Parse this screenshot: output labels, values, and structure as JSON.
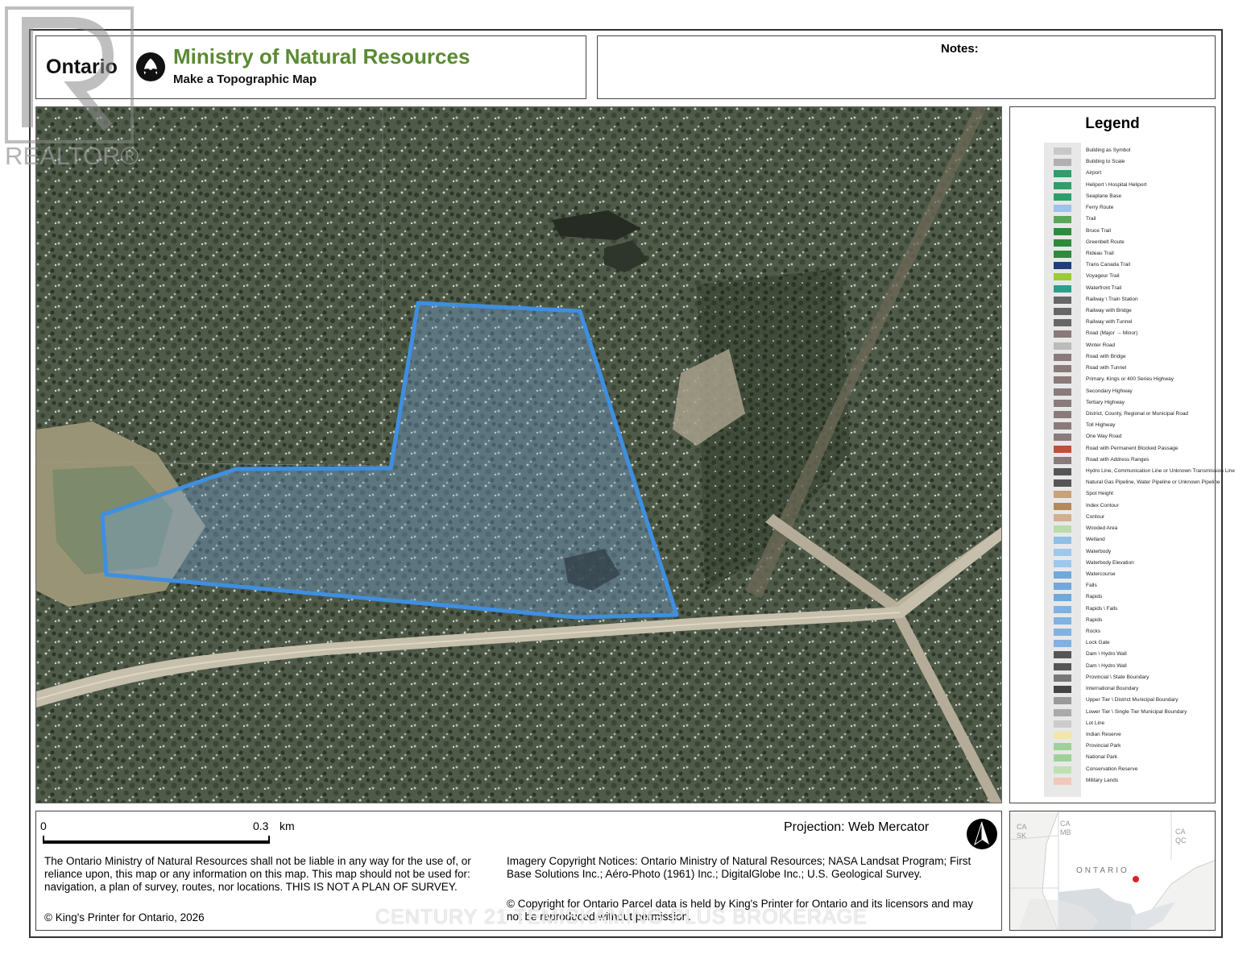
{
  "header": {
    "ontario_wordmark": "Ontario",
    "ministry": "Ministry of Natural Resources",
    "subtitle": "Make a Topographic Map"
  },
  "notes": {
    "label": "Notes:"
  },
  "legend": {
    "title": "Legend",
    "items": [
      {
        "label": "Building as Symbol",
        "color": "#c8c8c8"
      },
      {
        "label": "Building to Scale",
        "color": "#b0b0b0"
      },
      {
        "label": "Airport",
        "color": "#2e9e6a"
      },
      {
        "label": "Heliport \\ Hospital Heliport",
        "color": "#2e9e6a"
      },
      {
        "label": "Seaplane Base",
        "color": "#2e9e6a"
      },
      {
        "label": "Ferry Route",
        "color": "#9cc3ea"
      },
      {
        "label": "Trail",
        "color": "#58a85a"
      },
      {
        "label": "Bruce Trail",
        "color": "#2e8b3c"
      },
      {
        "label": "Greenbelt Route",
        "color": "#2e8b3c"
      },
      {
        "label": "Rideau Trail",
        "color": "#2e8b3c"
      },
      {
        "label": "Trans Canada Trail",
        "color": "#1f3f7a"
      },
      {
        "label": "Voyageur Trail",
        "color": "#9acd32"
      },
      {
        "label": "Waterfront Trail",
        "color": "#2e9e8a"
      },
      {
        "label": "Railway \\ Train Station",
        "color": "#666666"
      },
      {
        "label": "Railway with Bridge",
        "color": "#666666"
      },
      {
        "label": "Railway with Tunnel",
        "color": "#666666"
      },
      {
        "label": "Road (Major → Minor)",
        "color": "#8a7a7a"
      },
      {
        "label": "Winter Road",
        "color": "#bbbbbb"
      },
      {
        "label": "Road with Bridge",
        "color": "#8a7a7a"
      },
      {
        "label": "Road with Tunnel",
        "color": "#8a7a7a"
      },
      {
        "label": "Primary, Kings or 400 Series Highway",
        "color": "#8a7a7a"
      },
      {
        "label": "Secondary Highway",
        "color": "#8a7a7a"
      },
      {
        "label": "Tertiary Highway",
        "color": "#8a7a7a"
      },
      {
        "label": "District, County, Regional or Municipal Road",
        "color": "#8a7a7a"
      },
      {
        "label": "Toll Highway",
        "color": "#8a7a7a"
      },
      {
        "label": "One Way Road",
        "color": "#8a7a7a"
      },
      {
        "label": "Road with Permanent Blocked Passage",
        "color": "#c0503a"
      },
      {
        "label": "Road with Address Ranges",
        "color": "#8a7a7a"
      },
      {
        "label": "Hydro Line, Communication Line or Unknown Transmission Line",
        "color": "#555555"
      },
      {
        "label": "Natural Gas Pipeline, Water Pipeline or Unknown Pipeline",
        "color": "#555555"
      },
      {
        "label": "Spot Height",
        "color": "#c9a27a"
      },
      {
        "label": "Index Contour",
        "color": "#b48a5a"
      },
      {
        "label": "Contour",
        "color": "#d0b090"
      },
      {
        "label": "Wooded Area",
        "color": "#b9dcaa"
      },
      {
        "label": "Wetland",
        "color": "#8fbfe8"
      },
      {
        "label": "Waterbody",
        "color": "#9cc8ee"
      },
      {
        "label": "Waterbody Elevation",
        "color": "#9cc8ee"
      },
      {
        "label": "Watercourse",
        "color": "#6fa8dc"
      },
      {
        "label": "Falls",
        "color": "#6fa8dc"
      },
      {
        "label": "Rapids",
        "color": "#6fa8dc"
      },
      {
        "label": "Rapids \\ Falls",
        "color": "#7fb2e2"
      },
      {
        "label": "Rapids",
        "color": "#7fb2e2"
      },
      {
        "label": "Rocks",
        "color": "#7fb2e2"
      },
      {
        "label": "Lock Gate",
        "color": "#7fb2e2"
      },
      {
        "label": "Dam \\ Hydro Wall",
        "color": "#555555"
      },
      {
        "label": "Dam \\ Hydro Wall",
        "color": "#555555"
      },
      {
        "label": "Provincial \\ State Boundary",
        "color": "#777777"
      },
      {
        "label": "International Boundary",
        "color": "#444444"
      },
      {
        "label": "Upper Tier \\ District Municipal Boundary",
        "color": "#999999"
      },
      {
        "label": "Lower Tier \\ Single Tier Municipal Boundary",
        "color": "#aaaaaa"
      },
      {
        "label": "Lot Line",
        "color": "#cccccc"
      },
      {
        "label": "Indian Reserve",
        "color": "#f3e6a8"
      },
      {
        "label": "Provincial Park",
        "color": "#9ed19a"
      },
      {
        "label": "National Park",
        "color": "#9ed19a"
      },
      {
        "label": "Conservation Reserve",
        "color": "#bfe0b0"
      },
      {
        "label": "Military Lands",
        "color": "#f2c7b8"
      }
    ]
  },
  "footer": {
    "scale_zero": "0",
    "scale_max": "0.3",
    "scale_unit": "km",
    "projection": "Projection: Web Mercator",
    "disclaimer": "The Ontario Ministry of Natural Resources shall not be liable in any way for the use of, or reliance upon, this map or any information on this map.  This map should not be used for: navigation, a plan of survey, routes, nor locations. THIS IS NOT A PLAN OF SURVEY.",
    "copyright_kp": "© King's Printer for Ontario,  2026",
    "imagery": "Imagery Copyright Notices: Ontario Ministry of Natural Resources; NASA Landsat Program; First Base Solutions Inc.; Aéro-Photo (1961) Inc.; DigitalGlobe Inc.; U.S. Geological Survey.",
    "parcel": "© Copyright for Ontario Parcel data is held by King's Printer for Ontario and its licensors and may not be reproduced without permission."
  },
  "inset": {
    "labels": [
      "CA SK",
      "CA MB",
      "CA QC",
      "ONTARIO"
    ],
    "marker_color": "#e02020"
  },
  "overlay": {
    "realtor_mark": "REALTOR®",
    "brokerage": "CENTURY 21 TEMISKAMING PLUS BROKERAGE"
  },
  "colors": {
    "ministry_green": "#5a8a32",
    "parcel_outline": "#3f8fe0",
    "parcel_fill": "rgba(120,170,230,0.35)"
  }
}
